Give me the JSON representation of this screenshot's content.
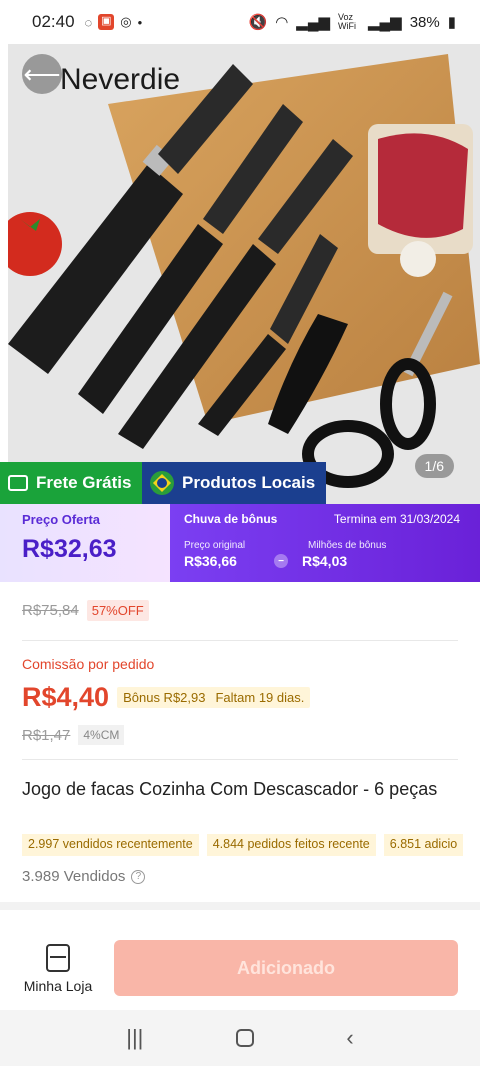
{
  "status_bar": {
    "time": "02:40",
    "battery": "38%",
    "network": "Voz WiFi"
  },
  "gallery": {
    "counter": "1/6",
    "brand": "Neverdie"
  },
  "badges": {
    "free_shipping": "Frete Grátis",
    "local_products": "Produtos Locais"
  },
  "promo": {
    "offer_label": "Preço Oferta",
    "offer_price": "R$32,63",
    "bonus_title": "Chuva de bônus",
    "ends": "Termina em 31/03/2024",
    "original_label": "Preço original",
    "original_value": "R$36,66",
    "bonus_label": "Milhões de bônus",
    "bonus_value": "R$4,03",
    "separator": "−"
  },
  "pricing": {
    "old_price": "R$75,84",
    "discount": "57%OFF"
  },
  "commission": {
    "label": "Comissão por pedido",
    "value": "R$4,40",
    "bonus": "Bônus R$2,93",
    "days_left": "Faltam 19 dias.",
    "old_value": "R$1,47",
    "rate": "4%CM"
  },
  "product": {
    "title": "Jogo de facas Cozinha Com Descascador - 6 peças",
    "chips": [
      "2.997 vendidos recentemente",
      "4.844 pedidos feitos recente",
      "6.851 adicio"
    ],
    "sold": "3.989 Vendidos"
  },
  "bottom_bar": {
    "store_label": "Minha Loja",
    "add_button": "Adicionado"
  },
  "colors": {
    "accent_red": "#e2462c",
    "purple": "#6a21d8",
    "green": "#1aa33a",
    "blue": "#1b3f8f"
  }
}
